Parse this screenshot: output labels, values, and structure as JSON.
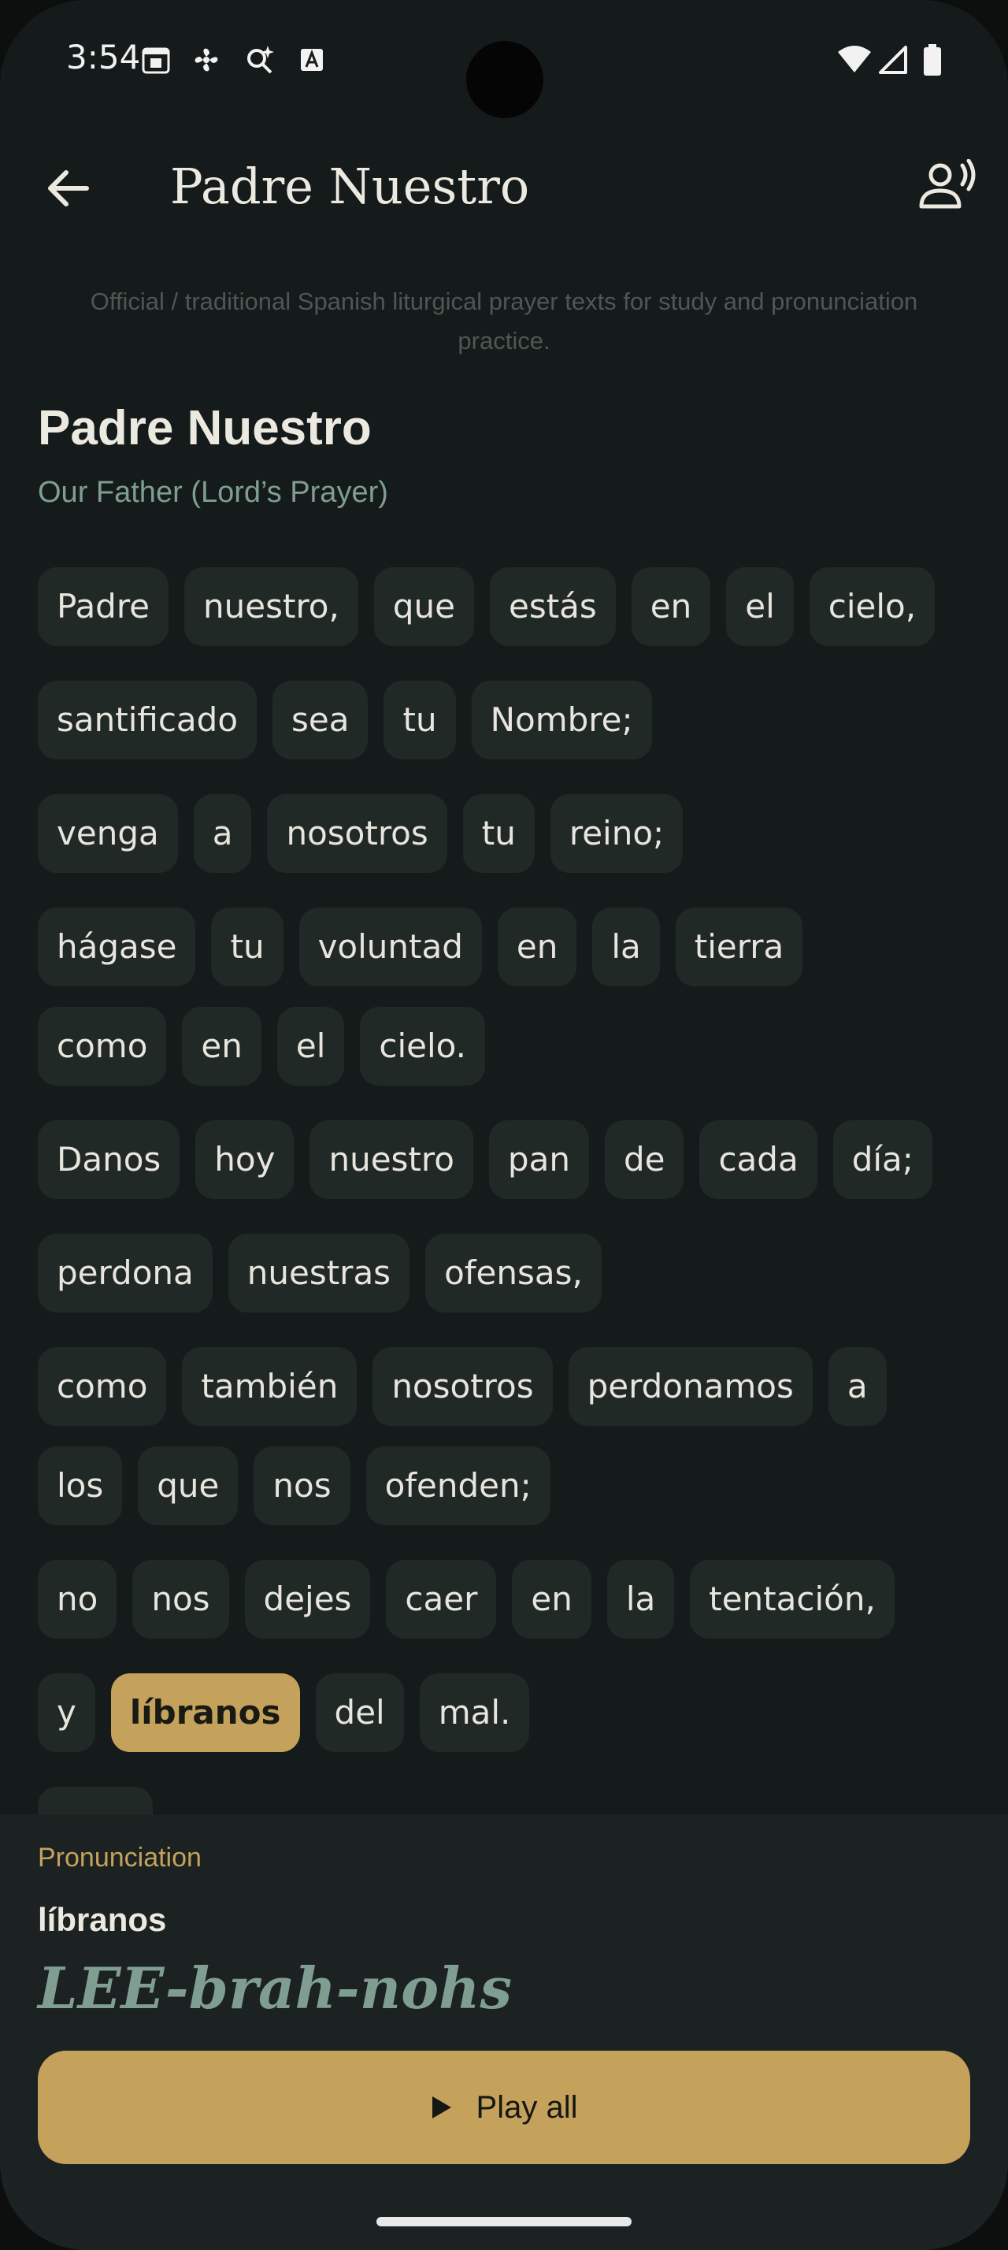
{
  "status": {
    "time": "3:54"
  },
  "appbar": {
    "title": "Padre Nuestro"
  },
  "intro": "Official / traditional Spanish liturgical prayer texts for study and pronunciation practice.",
  "prayer": {
    "title": "Padre Nuestro",
    "subtitle": "Our Father (Lord’s Prayer)",
    "lines": [
      [
        "Padre",
        "nuestro,",
        "que",
        "estás",
        "en",
        "el",
        "cielo,"
      ],
      [
        "santificado",
        "sea",
        "tu",
        "Nombre;"
      ],
      [
        "venga",
        "a",
        "nosotros",
        "tu",
        "reino;"
      ],
      [
        "hágase",
        "tu",
        "voluntad",
        "en",
        "la",
        "tierra"
      ],
      [
        "como",
        "en",
        "el",
        "cielo."
      ],
      [
        "Danos",
        "hoy",
        "nuestro",
        "pan",
        "de",
        "cada",
        "día;"
      ],
      [
        "perdona",
        "nuestras",
        "ofensas,"
      ],
      [
        "como",
        "también",
        "nosotros",
        "perdonamos",
        "a"
      ],
      [
        "los",
        "que",
        "nos",
        "ofenden;"
      ],
      [
        "no",
        "nos",
        "dejes",
        "caer",
        "en",
        "la",
        "tentación,"
      ],
      [
        "y",
        "líbranos",
        "del",
        "mal."
      ]
    ],
    "selected_word": "líbranos"
  },
  "panel": {
    "label": "Pronunciation",
    "word": "líbranos",
    "phonetic": "LEE-brah-nohs",
    "play_label": "Play all"
  },
  "icons": {
    "back": "arrow-back-icon",
    "voice": "record-voice-icon",
    "play": "play-icon"
  },
  "colors": {
    "background": "#151b1a",
    "chip": "#212927",
    "accent": "#c5a25c",
    "muted_green": "#7f9d90"
  }
}
